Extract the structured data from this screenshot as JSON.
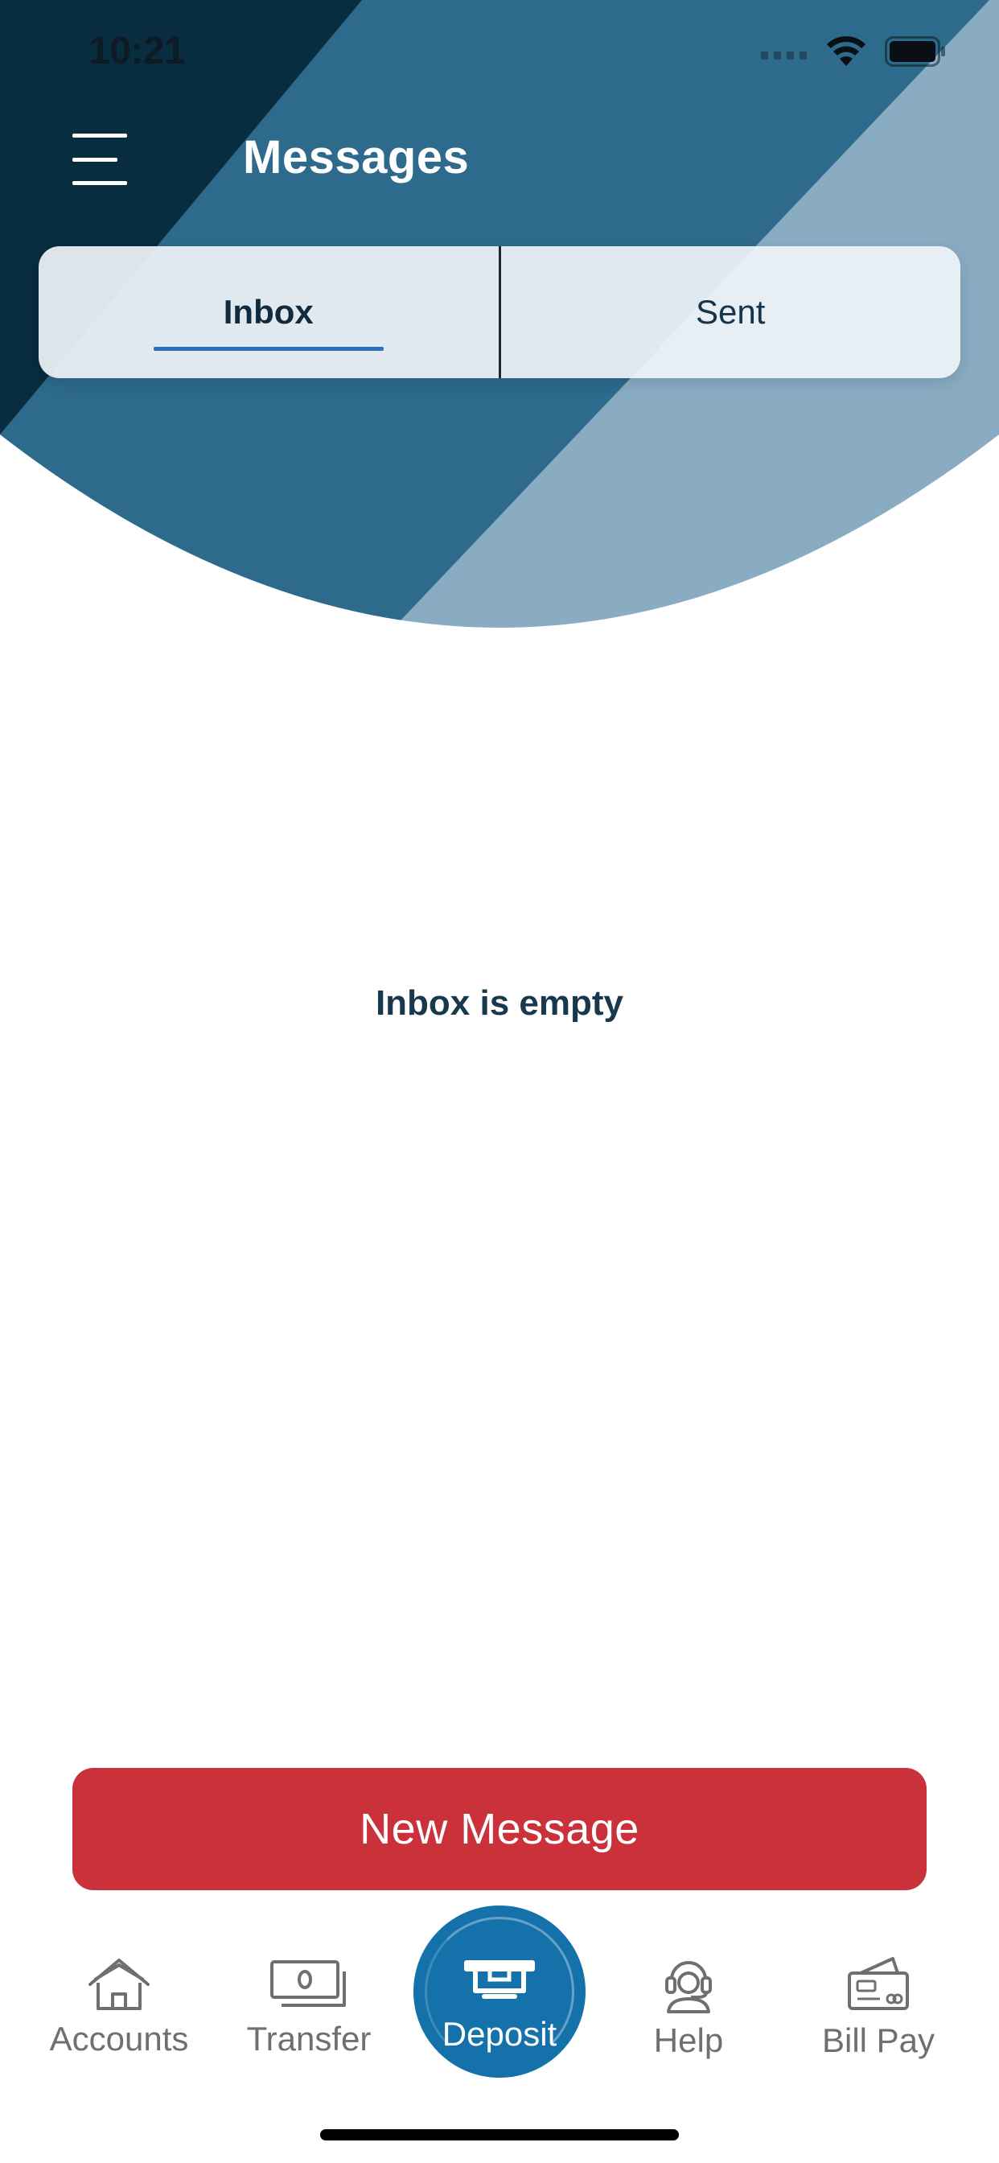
{
  "status_bar": {
    "time": "10:21"
  },
  "header": {
    "title": "Messages",
    "menu_icon": "hamburger-menu-icon"
  },
  "tabs": [
    {
      "label": "Inbox",
      "selected": true
    },
    {
      "label": "Sent",
      "selected": false
    }
  ],
  "empty_state": {
    "text": "Inbox is empty"
  },
  "actions": {
    "new_message_label": "New Message"
  },
  "tabbar": {
    "items": [
      {
        "label": "Accounts",
        "icon": "house-icon"
      },
      {
        "label": "Transfer",
        "icon": "cash-icon"
      },
      {
        "label": "Deposit",
        "icon": "atm-deposit-icon"
      },
      {
        "label": "Help",
        "icon": "headset-icon"
      },
      {
        "label": "Bill Pay",
        "icon": "wallet-card-icon"
      }
    ]
  },
  "colors": {
    "header_dark": "#082d40",
    "header_mid": "#2d6a8c",
    "header_light": "#89acc3",
    "accent_red": "#cb313b",
    "deposit_blue": "#1571aa",
    "tab_underline": "#2d6fb8"
  }
}
